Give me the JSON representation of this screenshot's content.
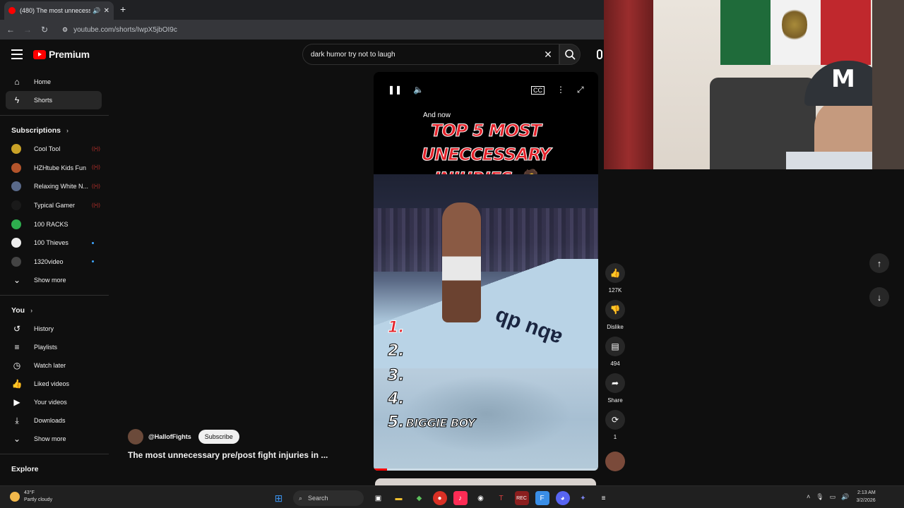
{
  "browser": {
    "tab_title": "(480) The most unnecessar",
    "new_tab": "+",
    "url_icon": "site-info-icon",
    "url": "youtube.com/shorts/IwpX5jbOI9c"
  },
  "header": {
    "logo_text": "Premium",
    "search_query": "dark humor try not to laugh",
    "clear": "✕"
  },
  "sidebar": {
    "main": [
      {
        "label": "Home",
        "icon": "⌂"
      },
      {
        "label": "Shorts",
        "icon": "ϟ"
      }
    ],
    "subscriptions_title": "Subscriptions",
    "subscriptions": [
      {
        "label": "Cool Tool",
        "color": "#c9a227",
        "badge": "live"
      },
      {
        "label": "HZHtube Kids Fun",
        "color": "#b3542b",
        "badge": "live"
      },
      {
        "label": "Relaxing White N...",
        "color": "#5a6a8a",
        "badge": "live"
      },
      {
        "label": "Typical Gamer",
        "color": "#1a1a1a",
        "badge": "live"
      },
      {
        "label": "100 RACKS",
        "color": "#2eae4e",
        "badge": ""
      },
      {
        "label": "100 Thieves",
        "color": "#eeeeee",
        "badge": "dot"
      },
      {
        "label": "1320video",
        "color": "#444444",
        "badge": "dot"
      }
    ],
    "show_more_1": "Show more",
    "you_title": "You",
    "you_items": [
      {
        "label": "History",
        "icon": "↺"
      },
      {
        "label": "Playlists",
        "icon": "≡"
      },
      {
        "label": "Watch later",
        "icon": "◷"
      },
      {
        "label": "Liked videos",
        "icon": "👍"
      },
      {
        "label": "Your videos",
        "icon": "▶"
      },
      {
        "label": "Downloads",
        "icon": "⤓"
      }
    ],
    "show_more_2": "Show more",
    "explore_title": "Explore"
  },
  "video": {
    "channel": "@HallofFights",
    "subscribe": "Subscribe",
    "title": "The most unnecessary pre/post fight injuries in ...",
    "overlay_small": "And now",
    "headline_1": "TOP 5 MOST UNECCESSARY",
    "headline_2": "INJURIES 🤦",
    "ranks": [
      "1.",
      "2.",
      "3.",
      "4.",
      "5."
    ],
    "rank5_name": "BIGGIE BOY",
    "progress": 0.06
  },
  "actions": {
    "likes": "127K",
    "dislike": "Dislike",
    "comments": "494",
    "share": "Share",
    "remix": "1"
  },
  "taskbar": {
    "temp": "43°F",
    "weather": "Partly cloudy",
    "search": "Search",
    "time": "2:13 AM",
    "date": "3/2/2026"
  }
}
